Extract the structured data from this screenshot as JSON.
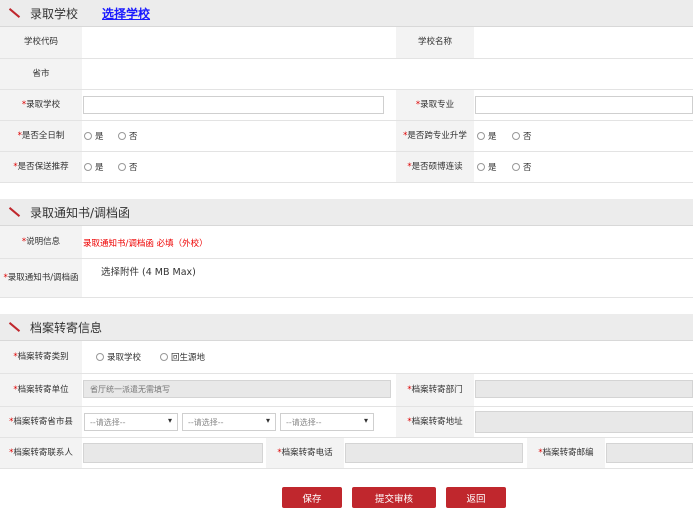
{
  "sec1": {
    "title": "录取学校",
    "link": "选择学校"
  },
  "r1": {
    "code_label": "学校代码",
    "name_label": "学校名称"
  },
  "r2": {
    "province_label": "省市"
  },
  "r3": {
    "school_label": "录取学校",
    "major_label": "录取专业"
  },
  "r4": {
    "fulltime_label": "是否全日制",
    "cross_label": "是否跨专业升学"
  },
  "r5": {
    "recommend_label": "是否保送推荐",
    "combined_label": "是否硕博连读"
  },
  "yes": "是",
  "no": "否",
  "req": "*",
  "sec2": {
    "title": "录取通知书/调档函"
  },
  "info": {
    "label": "说明信息",
    "text": "录取通知书/调档函 必填（外校）"
  },
  "attach": {
    "label": "录取通知书/调档函",
    "text": "选择附件 (4 MB Max)"
  },
  "sec3": {
    "title": "档案转寄信息"
  },
  "archive": {
    "type_label": "档案转寄类别",
    "opt_school": "录取学校",
    "opt_origin": "回生源地",
    "unit_label": "档案转寄单位",
    "unit_value": "省厅统一派遣无需填写",
    "dept_label": "档案转寄部门",
    "region_label": "档案转寄省市县",
    "select_placeholder": "--请选择--",
    "address_label": "档案转寄地址",
    "contact_label": "档案转寄联系人",
    "phone_label": "档案转寄电话",
    "zip_label": "档案转寄邮编"
  },
  "buttons": {
    "save": "保存",
    "submit": "提交审核",
    "back": "返回"
  },
  "colors": {
    "accent": "#c0272d",
    "link": "#1a1aff",
    "required": "#dd0000"
  }
}
